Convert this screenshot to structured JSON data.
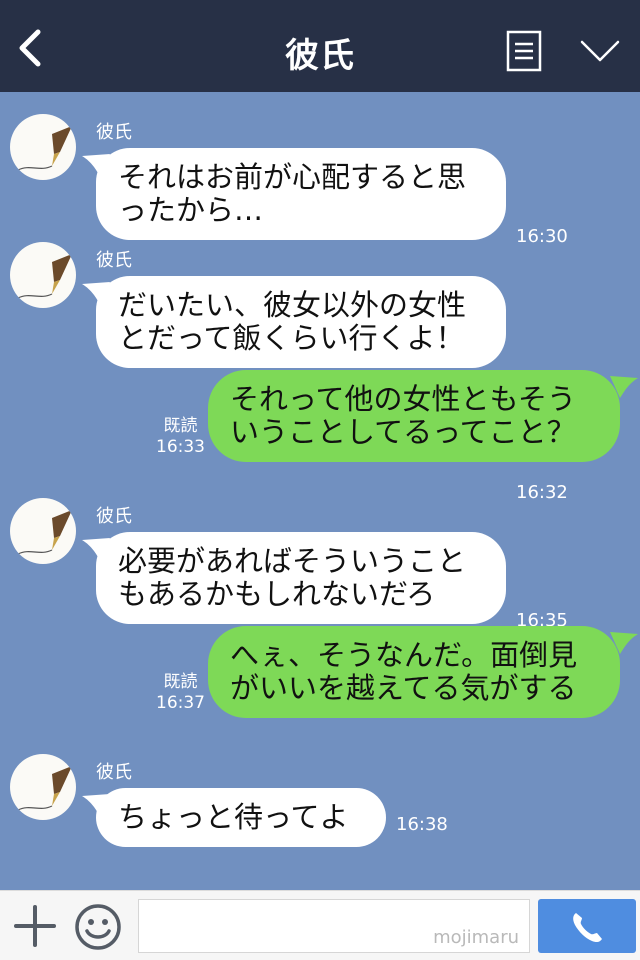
{
  "header": {
    "title": "彼氏",
    "back_icon": "chevron-left-icon",
    "menu_icon": "list-icon",
    "collapse_icon": "chevron-down-icon",
    "background": "#273046"
  },
  "chat": {
    "background": "#7190c0",
    "messages": [
      {
        "from": "them",
        "sender": "彼氏",
        "text": "それはお前が心配すると思\nったから…",
        "time": "16:30"
      },
      {
        "from": "them",
        "sender": "彼氏",
        "text": "だいたい、彼女以外の女性\nとだって飯くらい行くよ！",
        "time": "16:32"
      },
      {
        "from": "me",
        "text": "それって他の女性ともそう\nいうことしてるってこと？",
        "read": "既読",
        "time": "16:33"
      },
      {
        "from": "them",
        "sender": "彼氏",
        "text": "必要があればそういうこと\nもあるかもしれないだろ",
        "time": "16:35"
      },
      {
        "from": "me",
        "text": "へぇ、そうなんだ。面倒見\nがいいを越えてる気がする",
        "read": "既読",
        "time": "16:37"
      },
      {
        "from": "them",
        "sender": "彼氏",
        "text": "ちょっと待ってよ",
        "time": "16:38"
      }
    ]
  },
  "input_bar": {
    "plus_icon": "plus-icon",
    "emoji_icon": "emoji-icon",
    "watermark": "mojimaru",
    "call_icon": "phone-icon",
    "call_color": "#4f8de0"
  },
  "colors": {
    "my_bubble": "#7ed957",
    "their_bubble": "#ffffff"
  }
}
